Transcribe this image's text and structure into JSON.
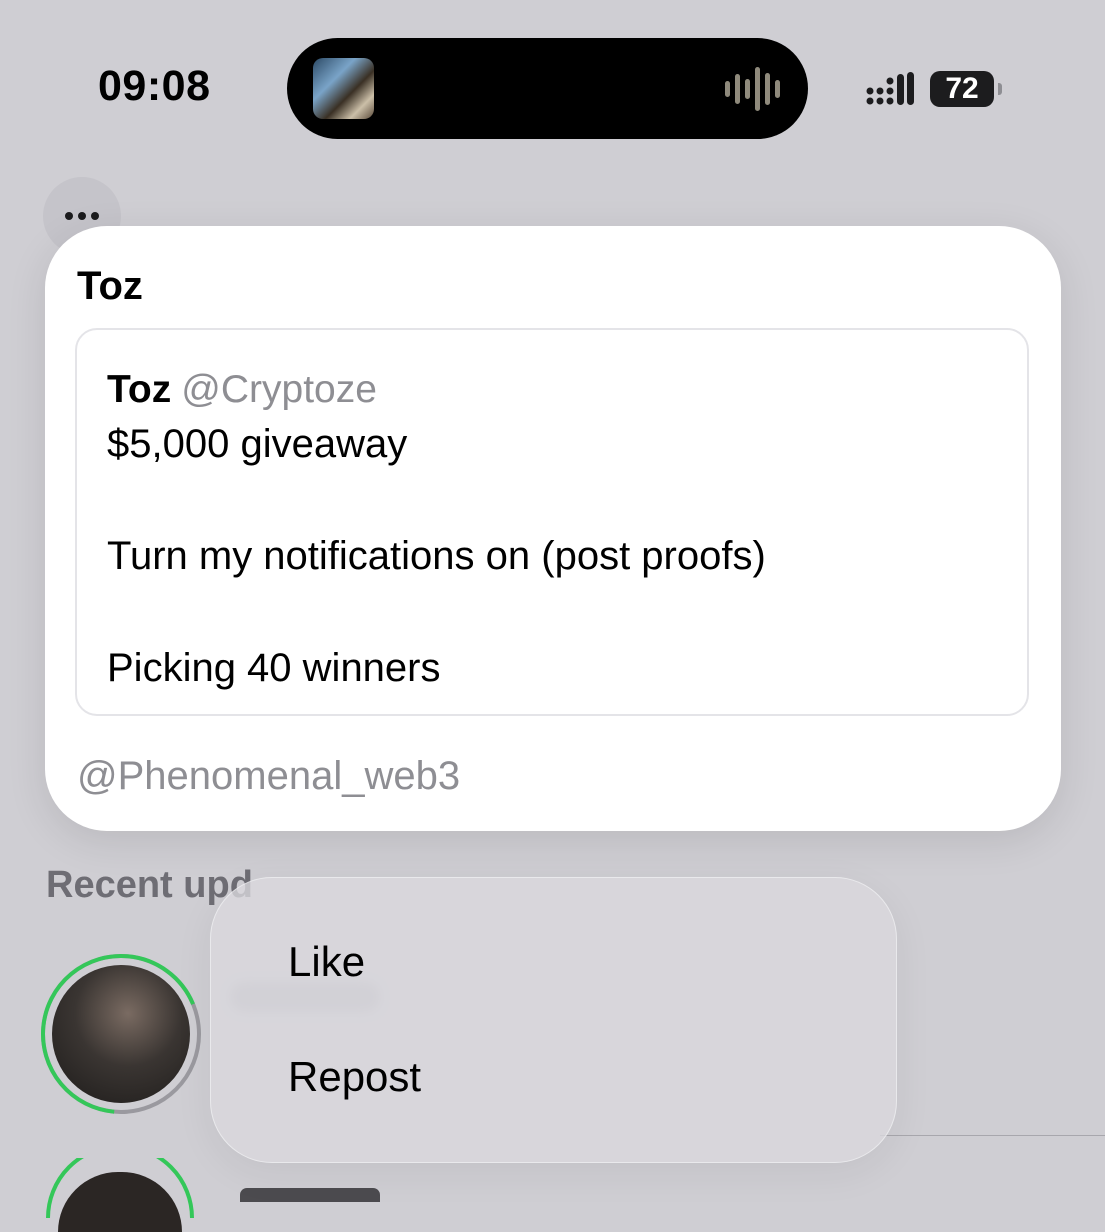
{
  "status_bar": {
    "time": "09:08",
    "battery": "72",
    "icons": [
      "signal-icon",
      "battery-icon",
      "audio-waveform-icon"
    ]
  },
  "card": {
    "title": "Toz",
    "quote": {
      "name": "Toz",
      "handle": "@Cryptoze",
      "lines": [
        "$5,000 giveaway",
        "Turn my notifications on (post proofs)",
        "Picking 40 winners"
      ]
    },
    "footer": "@Phenomenal_web3"
  },
  "background": {
    "section_title": "Recent upd"
  },
  "menu": {
    "items": [
      "Like",
      "Repost"
    ]
  },
  "colors": {
    "background": "#cfced3",
    "card": "#ffffff",
    "secondary_text": "#8e8e93",
    "ring_green": "#34c759"
  }
}
